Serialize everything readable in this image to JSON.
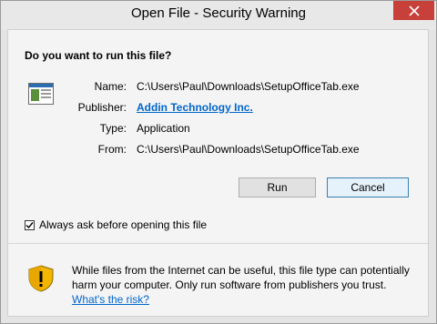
{
  "window": {
    "title": "Open File - Security Warning"
  },
  "dialog": {
    "question": "Do you want to run this file?",
    "fields": [
      {
        "label": "Name:",
        "value": "C:\\Users\\Paul\\Downloads\\SetupOfficeTab.exe"
      },
      {
        "label": "Publisher:",
        "value": "Addin Technology Inc."
      },
      {
        "label": "Type:",
        "value": "Application"
      },
      {
        "label": "From:",
        "value": "C:\\Users\\Paul\\Downloads\\SetupOfficeTab.exe"
      }
    ],
    "buttons": {
      "run": "Run",
      "cancel": "Cancel"
    },
    "checkbox": {
      "label": "Always ask before opening this file",
      "checked": true
    },
    "warning": {
      "text": "While files from the Internet can be useful, this file type can potentially harm your computer. Only run software from publishers you trust.",
      "link": "What's the risk?"
    }
  },
  "colors": {
    "close_button": "#c7403a",
    "link": "#0066cc",
    "shield": "#f2b500"
  },
  "icons": {
    "close": "close-icon",
    "file": "application-file-icon",
    "shield": "warning-shield-icon",
    "check": "check-icon"
  }
}
